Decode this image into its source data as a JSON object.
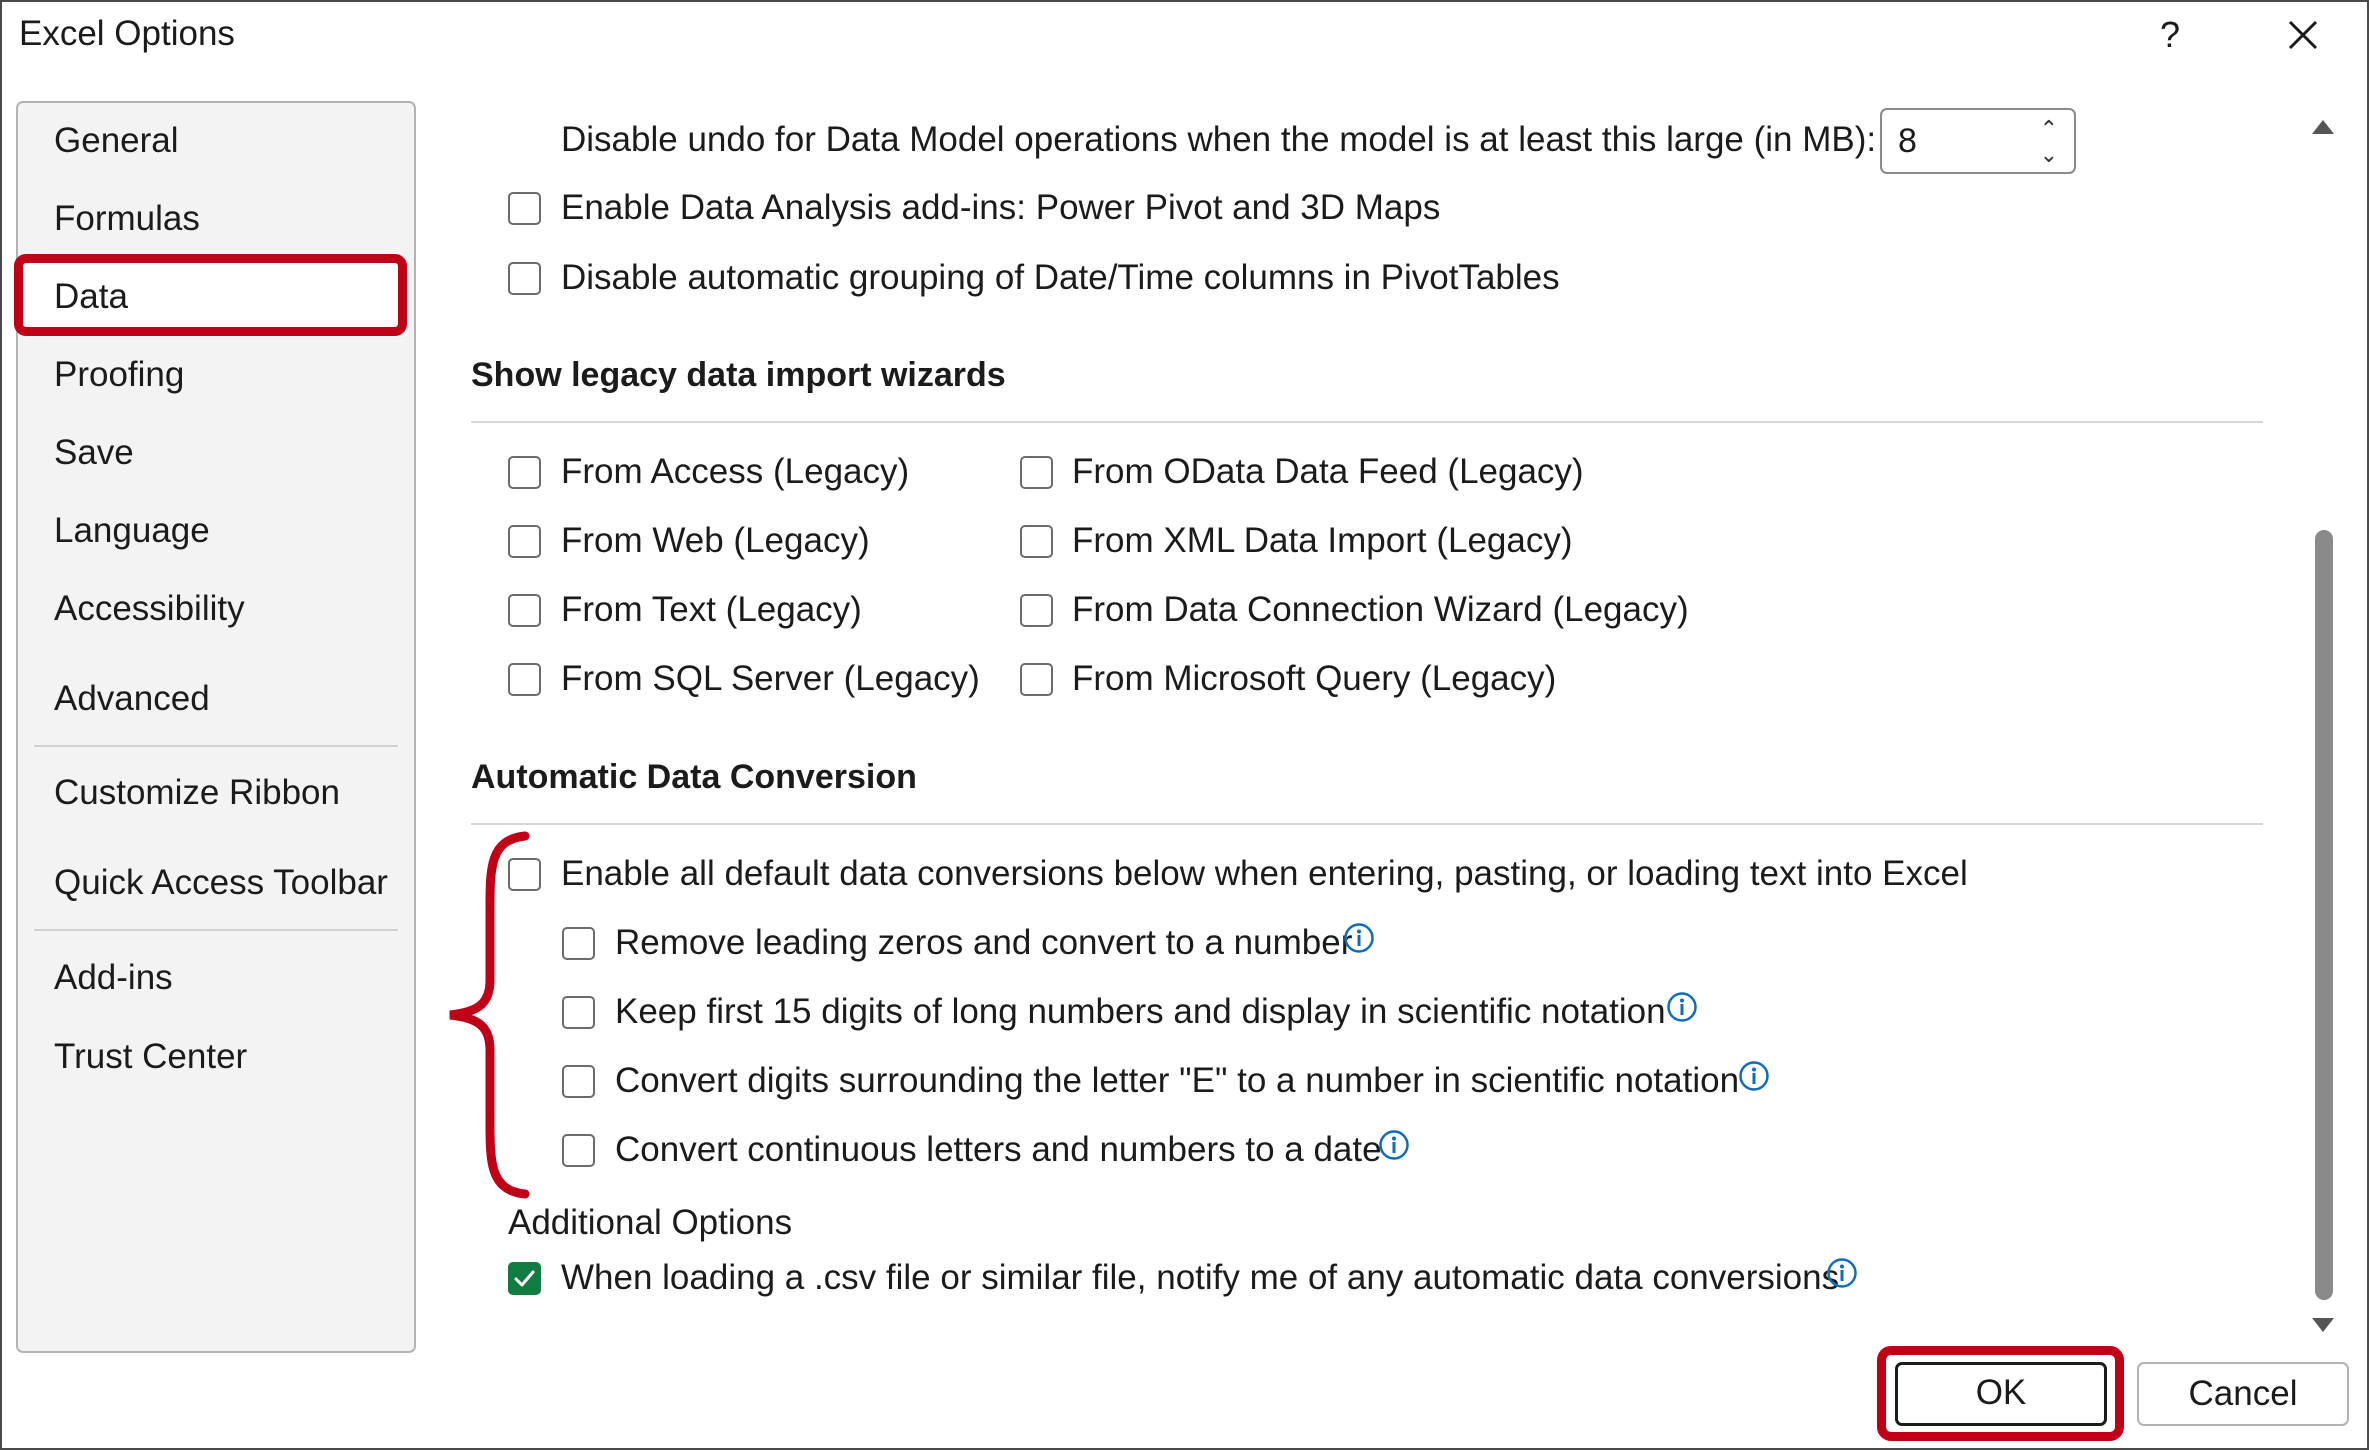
{
  "window": {
    "title": "Excel Options",
    "help_label": "?"
  },
  "nav": {
    "items": [
      {
        "label": "General"
      },
      {
        "label": "Formulas"
      },
      {
        "label": "Data",
        "selected": true
      },
      {
        "label": "Proofing"
      },
      {
        "label": "Save"
      },
      {
        "label": "Language"
      },
      {
        "label": "Accessibility"
      },
      {
        "label": "Advanced"
      },
      {
        "label": "Customize Ribbon"
      },
      {
        "label": "Quick Access Toolbar"
      },
      {
        "label": "Add-ins"
      },
      {
        "label": "Trust Center"
      }
    ]
  },
  "data_options": {
    "undo_label": "Disable undo for Data Model operations when the model is at least this large (in MB):",
    "undo_value": "8",
    "enable_addins": {
      "label": "Enable Data Analysis add-ins: Power Pivot and 3D Maps",
      "checked": false
    },
    "disable_grouping": {
      "label": "Disable automatic grouping of Date/Time columns in PivotTables",
      "checked": false
    }
  },
  "legacy": {
    "header": "Show legacy data import wizards",
    "left": [
      {
        "label": "From Access (Legacy)",
        "checked": false
      },
      {
        "label": "From Web (Legacy)",
        "checked": false
      },
      {
        "label": "From Text (Legacy)",
        "checked": false
      },
      {
        "label": "From SQL Server (Legacy)",
        "checked": false
      }
    ],
    "right": [
      {
        "label": "From OData Data Feed (Legacy)",
        "checked": false
      },
      {
        "label": "From XML Data Import (Legacy)",
        "checked": false
      },
      {
        "label": "From Data Connection Wizard (Legacy)",
        "checked": false
      },
      {
        "label": "From Microsoft Query (Legacy)",
        "checked": false
      }
    ]
  },
  "conversion": {
    "header": "Automatic Data Conversion",
    "enable_all": {
      "label": "Enable all default data conversions below when entering, pasting, or loading text into Excel",
      "checked": false
    },
    "options": [
      {
        "label": "Remove leading zeros and convert to a number",
        "checked": false
      },
      {
        "label": "Keep first 15 digits of long numbers and display in scientific notation",
        "checked": false
      },
      {
        "label": "Convert digits surrounding the letter \"E\" to a number in scientific notation",
        "checked": false
      },
      {
        "label": "Convert continuous letters and numbers to a date",
        "checked": false
      }
    ],
    "additional_header": "Additional Options",
    "notify": {
      "label": "When loading a .csv file or similar file, notify me of any automatic data conversions",
      "checked": true
    }
  },
  "buttons": {
    "ok": "OK",
    "cancel": "Cancel"
  },
  "colors": {
    "highlight": "#c00017",
    "checked": "#107c41",
    "info": "#0f6cbd"
  }
}
